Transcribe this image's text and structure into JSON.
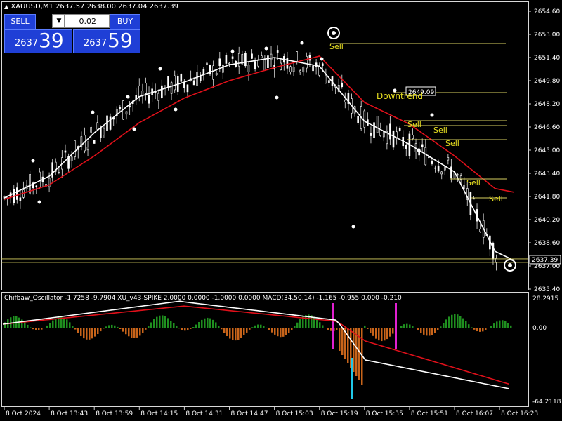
{
  "header": {
    "symbol_line": "XAUUSD,M1  2637.57 2638.00 2637.04 2637.39"
  },
  "trade_panel": {
    "sell_label": "SELL",
    "buy_label": "BUY",
    "lot_value": "0.02",
    "sell_price_prefix": "2637",
    "sell_price_big": "39",
    "buy_price_prefix": "2637",
    "buy_price_big": "59"
  },
  "price_axis": [
    "2654.60",
    "2653.00",
    "2651.40",
    "2649.80",
    "2648.20",
    "2646.60",
    "2645.00",
    "2643.40",
    "2641.80",
    "2640.20",
    "2638.60",
    "2637.00",
    "2635.40"
  ],
  "current_price_label": "2637.39",
  "level_label": "2649.09",
  "annotations": {
    "downtrend": "Downtrend",
    "sell": "Sell"
  },
  "oscillator": {
    "header": "Chifbaw_Oscillator -1.7258 -9.7904  XU_v43-SPIKE 2.0000 0.0000 -1.0000 0.0000  MACD(34,50,14) -1.165 -0.955 0.000 -0.210",
    "axis": [
      "28.2915",
      "0.00",
      "-64.2118"
    ]
  },
  "time_axis": [
    "8 Oct 2024",
    "8 Oct 13:43",
    "8 Oct 13:59",
    "8 Oct 14:15",
    "8 Oct 14:31",
    "8 Oct 14:47",
    "8 Oct 15:03",
    "8 Oct 15:19",
    "8 Oct 15:35",
    "8 Oct 15:51",
    "8 Oct 16:07",
    "8 Oct 16:23"
  ],
  "colors": {
    "background": "#000000",
    "fast_ma": "#ffffff",
    "slow_ma": "#e0101a",
    "level_line": "#d8d060",
    "hist_up": "#1f8f1f",
    "hist_down": "#c8641a",
    "spike_magenta": "#e020d0",
    "spike_cyan": "#20c8e8",
    "annotation_text": "#e8e020"
  },
  "chart_data": {
    "type": "line",
    "title": "XAUUSD,M1",
    "ylim": [
      2635.4,
      2654.6
    ],
    "x": [
      "8 Oct 2024",
      "8 Oct 13:43",
      "8 Oct 13:59",
      "8 Oct 14:15",
      "8 Oct 14:31",
      "8 Oct 14:47",
      "8 Oct 15:03",
      "8 Oct 15:19",
      "8 Oct 15:35",
      "8 Oct 15:51",
      "8 Oct 16:07",
      "8 Oct 16:23"
    ],
    "series": [
      {
        "values": [
          2641.7,
          2643.2,
          2646.2,
          2648.7,
          2649.7,
          2650.9,
          2651.4,
          2650.8,
          2647.0,
          2645.4,
          2643.5,
          2637.4
        ]
      },
      {
        "values": [
          2641.6,
          2642.6,
          2644.6,
          2646.9,
          2648.6,
          2649.8,
          2650.7,
          2651.5,
          2648.3,
          2646.8,
          2644.6,
          2642.1
        ]
      }
    ]
  }
}
